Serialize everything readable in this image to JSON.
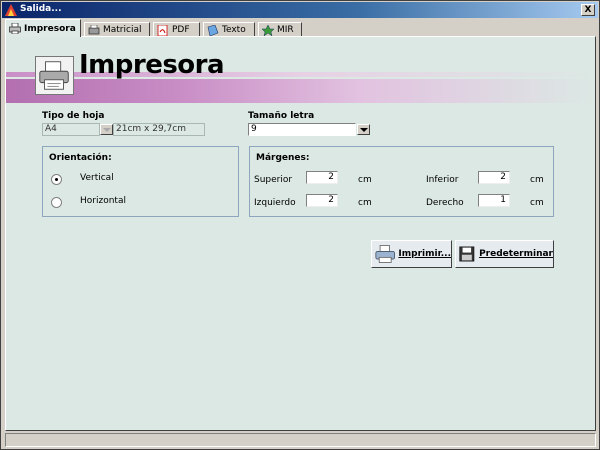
{
  "window": {
    "title": "Salida...",
    "close_label": "X"
  },
  "tabs": [
    {
      "label": "Impresora",
      "icon": "printer-icon",
      "active": true
    },
    {
      "label": "Matricial",
      "icon": "dot-matrix-printer-icon",
      "active": false
    },
    {
      "label": "PDF",
      "icon": "pdf-icon",
      "active": false
    },
    {
      "label": "Texto",
      "icon": "text-file-icon",
      "active": false
    },
    {
      "label": "MIR",
      "icon": "mir-icon",
      "active": false
    }
  ],
  "banner": {
    "title": "Impresora",
    "icon": "printer-icon"
  },
  "paper": {
    "label": "Tipo de hoja",
    "value": "A4",
    "size": "21cm x 29,7cm"
  },
  "font_size": {
    "label": "Tamaño letra",
    "value": "9"
  },
  "orientation": {
    "title": "Orientación:",
    "options": [
      {
        "label": "Vertical",
        "selected": true
      },
      {
        "label": "Horizontal",
        "selected": false
      }
    ]
  },
  "margins": {
    "title": "Márgenes:",
    "unit": "cm",
    "superior": {
      "label": "Superior",
      "value": "2"
    },
    "inferior": {
      "label": "Inferior",
      "value": "2"
    },
    "izquierdo": {
      "label": "Izquierdo",
      "value": "2"
    },
    "derecho": {
      "label": "Derecho",
      "value": "1"
    }
  },
  "buttons": {
    "print": {
      "label": "Imprimir...",
      "icon": "printer-icon"
    },
    "default": {
      "label": "Predeterminar",
      "icon": "save-icon"
    }
  },
  "colors": {
    "accent": "#b36fb0",
    "panel": "#dce8e4",
    "titlebar": "#0a246a"
  }
}
